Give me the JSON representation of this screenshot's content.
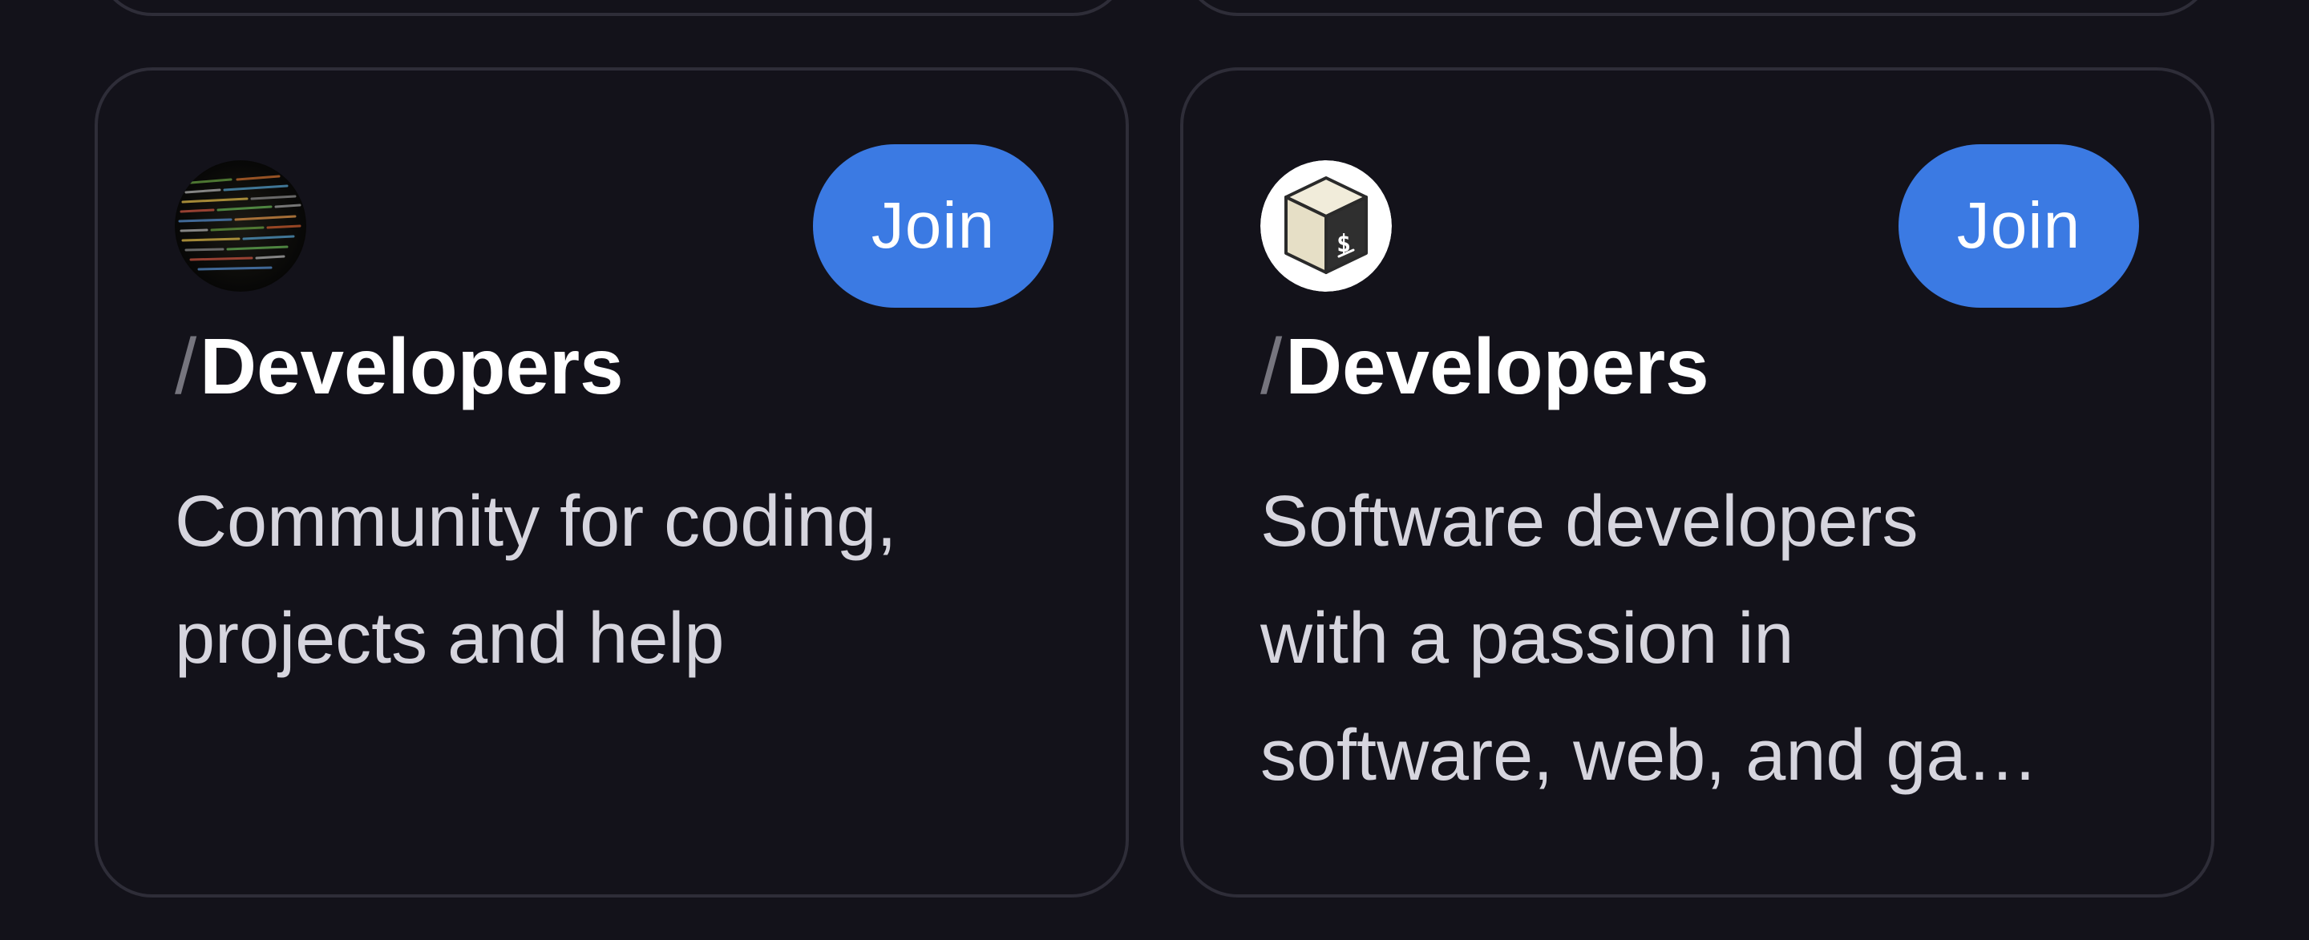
{
  "cards": [
    {
      "avatar_icon": "code-screen-avatar-icon",
      "join_label": "Join",
      "slash": "/",
      "name": "Developers",
      "description_lines": [
        "Community for coding,",
        "projects and help"
      ]
    },
    {
      "avatar_icon": "terminal-box-avatar-icon",
      "join_label": "Join",
      "slash": "/",
      "name": "Developers",
      "description_lines": [
        "Software developers",
        "with a passion in",
        "software, web, and ga…"
      ]
    }
  ],
  "colors": {
    "background": "#13121a",
    "card_border": "#2e2d38",
    "join_button": "#3b7ae3",
    "title": "#ffffff",
    "slash": "#76757e",
    "description": "#d6d5de"
  }
}
